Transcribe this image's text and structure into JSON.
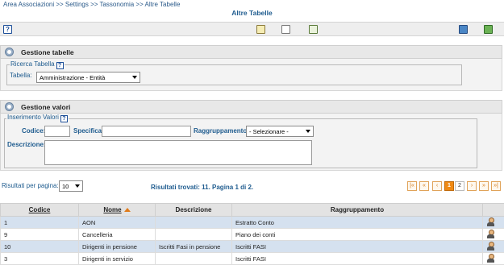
{
  "breadcrumb": "Area Associazioni >> Settings >> Tassonomia >> Altre Tabelle",
  "page_title": "Altre Tabelle",
  "toolbar": {
    "help_icon": "?"
  },
  "gestione_tabelle": {
    "title": "Gestione tabelle",
    "ricerca_legend": "Ricerca Tabella",
    "tabella_label": "Tabella:",
    "tabella_value": "Amministrazione - Entità"
  },
  "gestione_valori": {
    "title": "Gestione valori",
    "inserimento_legend": "Inserimento Valori",
    "codice_label": "Codice:",
    "specifica_label": "Specifica:",
    "raggruppamento_label": "Raggruppamento:",
    "raggruppamento_value": "- Selezionare -",
    "descrizione_label": "Descrizione:",
    "codice_value": "",
    "specifica_value": "",
    "descrizione_value": ""
  },
  "results": {
    "per_page_label": "Risultati per pagina:",
    "per_page_value": "10",
    "found_text": "Risultati trovati: 11. Pagina 1 di 2.",
    "pages": [
      "1",
      "2"
    ],
    "current_page": "1"
  },
  "table": {
    "headers": {
      "codice": "Codice",
      "nome": "Nome",
      "descrizione": "Descrizione",
      "raggruppamento": "Raggruppamento"
    },
    "rows": [
      {
        "codice": "1",
        "nome": "AON",
        "descrizione": "",
        "raggruppamento": "Estratto Conto"
      },
      {
        "codice": "9",
        "nome": "Cancelleria",
        "descrizione": "",
        "raggruppamento": "Piano dei conti"
      },
      {
        "codice": "10",
        "nome": "Dirigenti in pensione",
        "descrizione": "Iscritti Fasi in pensione",
        "raggruppamento": "Iscritti FASI"
      },
      {
        "codice": "3",
        "nome": "Dirigenti in servizio",
        "descrizione": "",
        "raggruppamento": "Iscritti FASI"
      }
    ]
  }
}
